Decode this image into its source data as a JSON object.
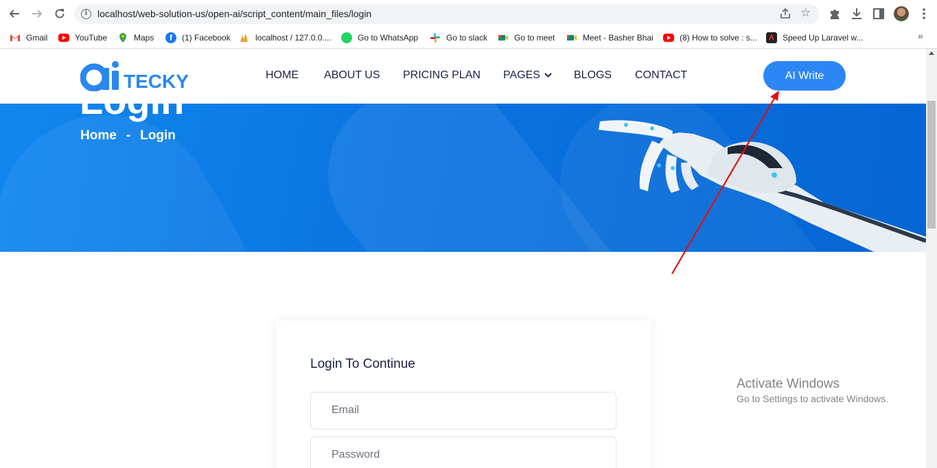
{
  "browser": {
    "url": "localhost/web-solution-us/open-ai/script_content/main_files/login",
    "bookmarks": [
      {
        "label": "Gmail",
        "icon": "gmail-icon",
        "color": "#ea4335"
      },
      {
        "label": "YouTube",
        "icon": "youtube-icon",
        "color": "#ff0000"
      },
      {
        "label": "Maps",
        "icon": "maps-icon",
        "color": "#34a853"
      },
      {
        "label": "(1) Facebook",
        "icon": "facebook-icon",
        "color": "#1877f2"
      },
      {
        "label": "localhost / 127.0.0....",
        "icon": "phpmyadmin-icon",
        "color": "#f0a030"
      },
      {
        "label": "Go to WhatsApp",
        "icon": "whatsapp-icon",
        "color": "#25d366"
      },
      {
        "label": "Go to slack",
        "icon": "slack-icon",
        "color": "#e01e5a"
      },
      {
        "label": "Go to meet",
        "icon": "meet-icon",
        "color": "#00897b"
      },
      {
        "label": "Meet - Basher Bhai",
        "icon": "meet-icon",
        "color": "#00897b"
      },
      {
        "label": "(8) How to solve : s...",
        "icon": "youtube-icon",
        "color": "#ff0000"
      },
      {
        "label": "Speed Up Laravel w...",
        "icon": "laravel-icon",
        "color": "#222222"
      }
    ]
  },
  "site": {
    "logo_text": "TECKY",
    "nav": [
      "HOME",
      "ABOUT US",
      "PRICING PLAN",
      "PAGES",
      "BLOGS",
      "CONTACT"
    ],
    "cta": "AI Write"
  },
  "hero": {
    "title": "Login",
    "breadcrumb_home": "Home",
    "breadcrumb_sep": "-",
    "breadcrumb_current": "Login"
  },
  "login": {
    "title": "Login To Continue",
    "email_placeholder": "Email",
    "password_placeholder": "Password"
  },
  "watermark": {
    "line1": "Activate Windows",
    "line2": "Go to Settings to activate Windows."
  },
  "colors": {
    "brand": "#2d86f5",
    "annotation_arrow": "#e01010"
  }
}
